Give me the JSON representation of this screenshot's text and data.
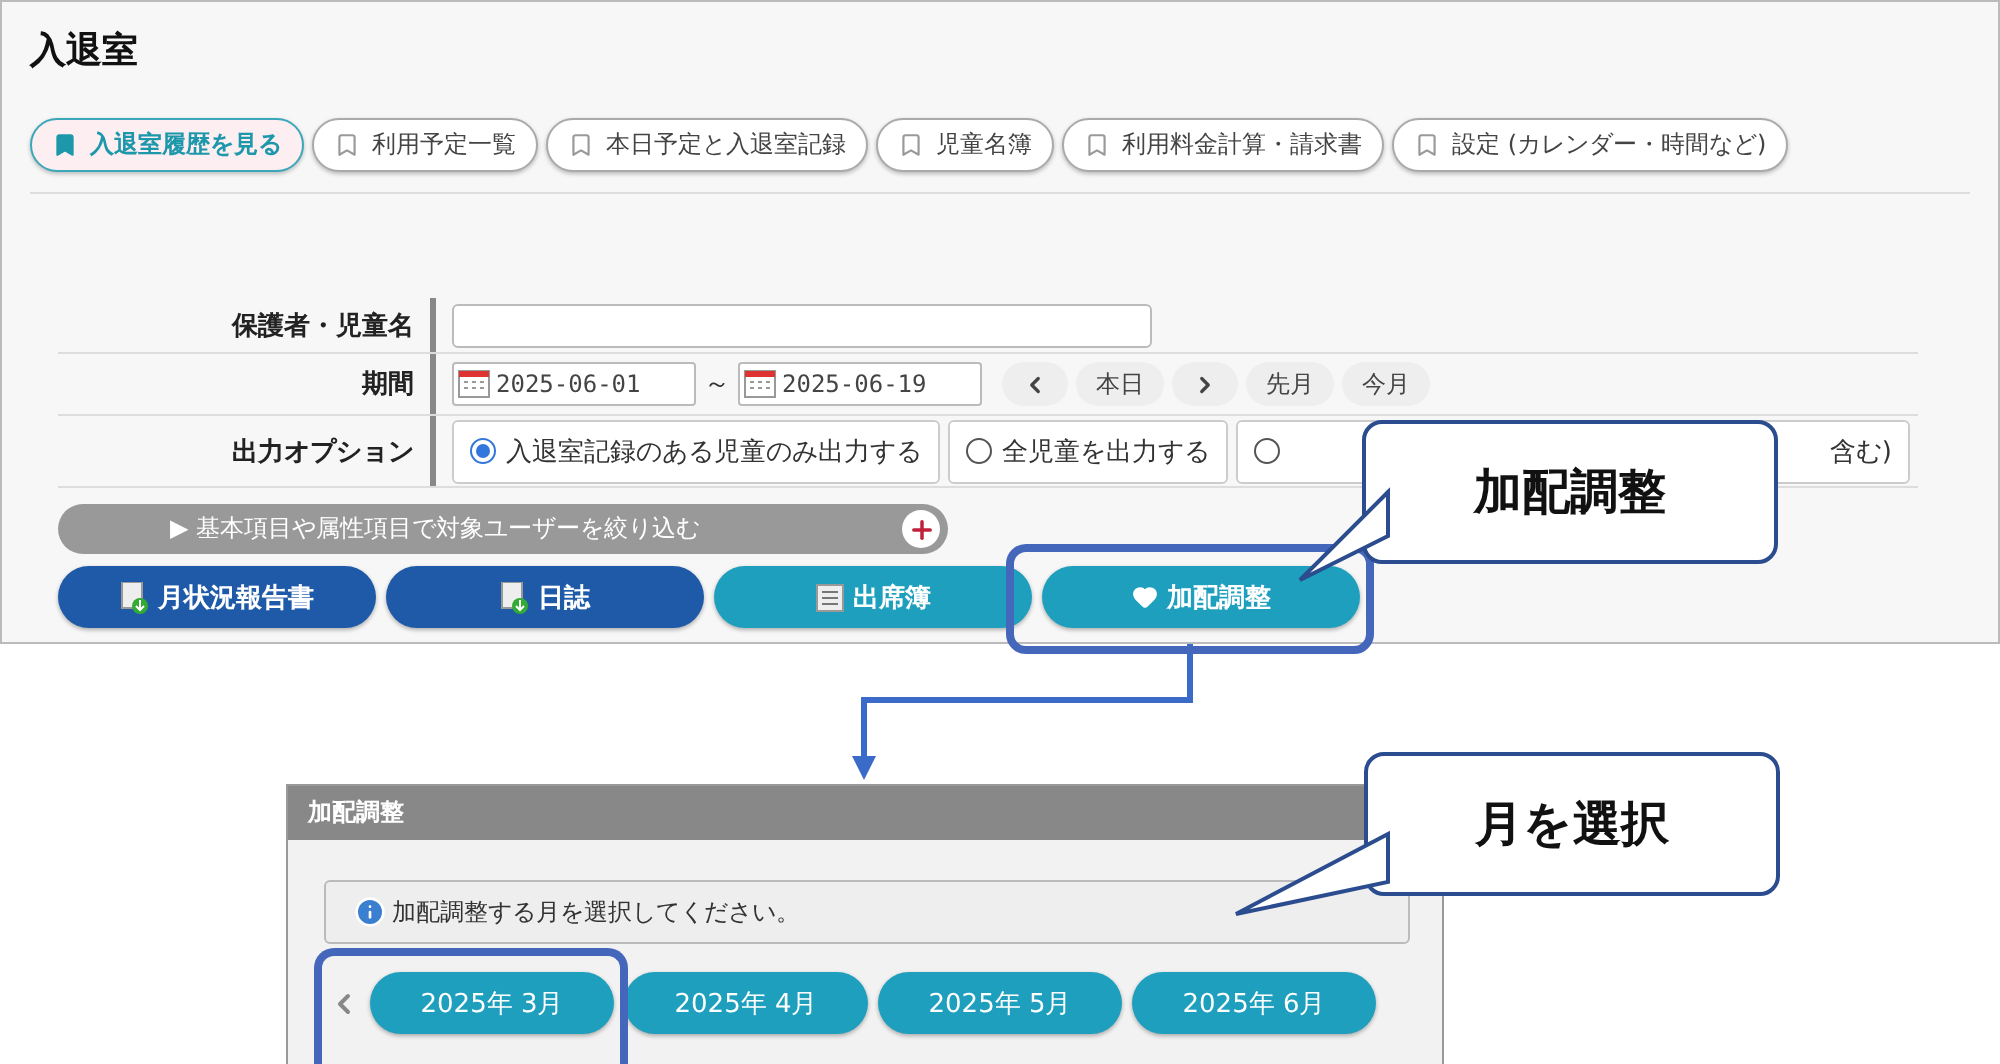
{
  "page_title": "入退室",
  "tabs": [
    {
      "label": "入退室履歴を見る",
      "selected": true
    },
    {
      "label": "利用予定一覧",
      "selected": false
    },
    {
      "label": "本日予定と入退室記録",
      "selected": false
    },
    {
      "label": "児童名簿",
      "selected": false
    },
    {
      "label": "利用料金計算・請求書",
      "selected": false
    },
    {
      "label": "設定 (カレンダー・時間など)",
      "selected": false
    }
  ],
  "form": {
    "name_label": "保護者・児童名",
    "period_label": "期間",
    "date_from": "2025-06-01",
    "range_sep": "～",
    "date_to": "2025-06-19",
    "period_buttons": [
      "本日",
      "先月",
      "今月"
    ],
    "option_label": "出力オプション",
    "options": [
      {
        "label": "入退室記録のある児童のみ出力する",
        "selected": true
      },
      {
        "label": "全児童を出力する",
        "selected": false
      },
      {
        "label": "含む)",
        "selected": false
      }
    ]
  },
  "filter_bar": "▶ 基本項目や属性項目で対象ユーザーを絞り込む",
  "actions": [
    {
      "label": "月状況報告書",
      "kind": "download"
    },
    {
      "label": "日誌",
      "kind": "download"
    },
    {
      "label": "出席簿",
      "kind": "ledger"
    },
    {
      "label": "加配調整",
      "kind": "heart"
    }
  ],
  "dialog": {
    "title": "加配調整",
    "message": "加配調整する月を選択してください。",
    "months": [
      "2025年 3月",
      "2025年 4月",
      "2025年 5月",
      "2025年 6月"
    ]
  },
  "callouts": [
    "加配調整",
    "月を選択"
  ]
}
